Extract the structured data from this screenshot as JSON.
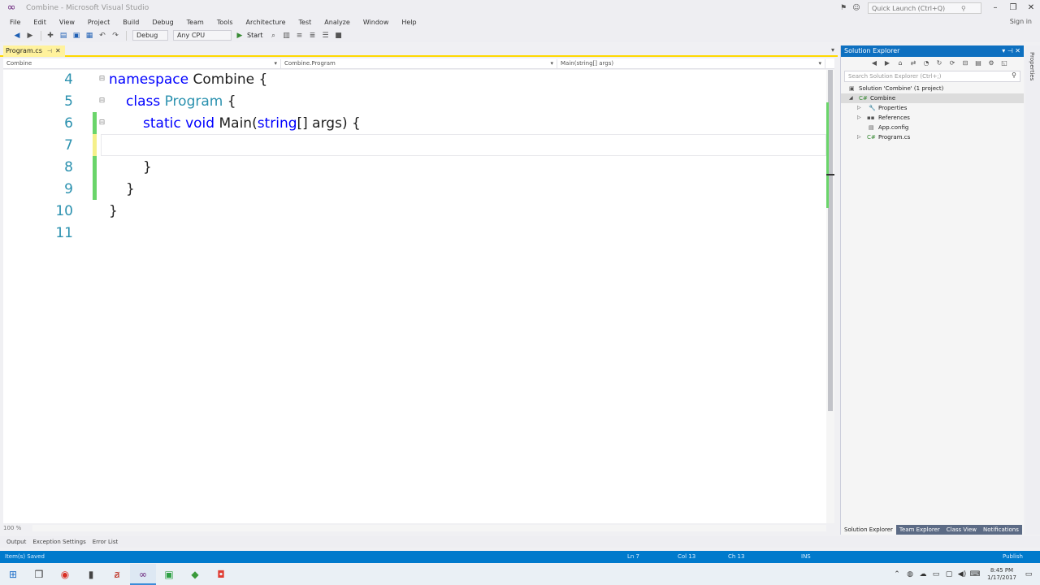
{
  "window": {
    "title": "Combine - Microsoft Visual Studio",
    "quick_launch_placeholder": "Quick Launch (Ctrl+Q)",
    "sign_in": "Sign in"
  },
  "menu": [
    "File",
    "Edit",
    "View",
    "Project",
    "Build",
    "Debug",
    "Team",
    "Tools",
    "Architecture",
    "Test",
    "Analyze",
    "Window",
    "Help"
  ],
  "toolbar": {
    "config": "Debug",
    "platform": "Any CPU",
    "start_label": "Start"
  },
  "document": {
    "tab_label": "Program.cs",
    "nav_project": "Combine",
    "nav_class": "Combine.Program",
    "nav_member": "Main(string[] args)"
  },
  "code_lines": [
    {
      "num": "4",
      "tokens": [
        {
          "t": "namespace",
          "c": "kw"
        },
        {
          "t": " Combine {",
          "c": ""
        }
      ]
    },
    {
      "num": "5",
      "tokens": [
        {
          "t": "class",
          "c": "kw"
        },
        {
          "t": " ",
          "c": ""
        },
        {
          "t": "Program",
          "c": "tp"
        },
        {
          "t": " {",
          "c": ""
        }
      ]
    },
    {
      "num": "6",
      "tokens": [
        {
          "t": "static",
          "c": "kw"
        },
        {
          "t": " ",
          "c": ""
        },
        {
          "t": "void",
          "c": "kw"
        },
        {
          "t": " Main(",
          "c": ""
        },
        {
          "t": "string",
          "c": "kw"
        },
        {
          "t": "[] args) {",
          "c": ""
        }
      ]
    },
    {
      "num": "7",
      "tokens": []
    },
    {
      "num": "8",
      "tokens": [
        {
          "t": "}",
          "c": ""
        }
      ]
    },
    {
      "num": "9",
      "tokens": [
        {
          "t": "}",
          "c": ""
        }
      ]
    },
    {
      "num": "10",
      "tokens": [
        {
          "t": "}",
          "c": ""
        }
      ]
    },
    {
      "num": "11",
      "tokens": []
    }
  ],
  "editor": {
    "zoom": "100 %"
  },
  "solution_explorer": {
    "title": "Solution Explorer",
    "search_placeholder": "Search Solution Explorer (Ctrl+;)",
    "tree": [
      {
        "label": "Solution 'Combine' (1 project)",
        "icon": "solution-icon"
      },
      {
        "label": "Combine",
        "icon": "csharp-project-icon"
      },
      {
        "label": "Properties",
        "icon": "wrench-icon"
      },
      {
        "label": "References",
        "icon": "references-icon"
      },
      {
        "label": "App.config",
        "icon": "config-file-icon"
      },
      {
        "label": "Program.cs",
        "icon": "csharp-file-icon"
      }
    ],
    "tabs": [
      "Solution Explorer",
      "Team Explorer",
      "Class View",
      "Notifications"
    ]
  },
  "properties_tab": "Properties",
  "bottom_tabs": [
    "Output",
    "Exception Settings",
    "Error List"
  ],
  "statusbar": {
    "left": "Item(s) Saved",
    "ln": "Ln 7",
    "col": "Col 13",
    "ch": "Ch 13",
    "mode": "INS",
    "publish": "Publish"
  },
  "clock": {
    "time": "8:45 PM",
    "date": "1/17/2017"
  }
}
